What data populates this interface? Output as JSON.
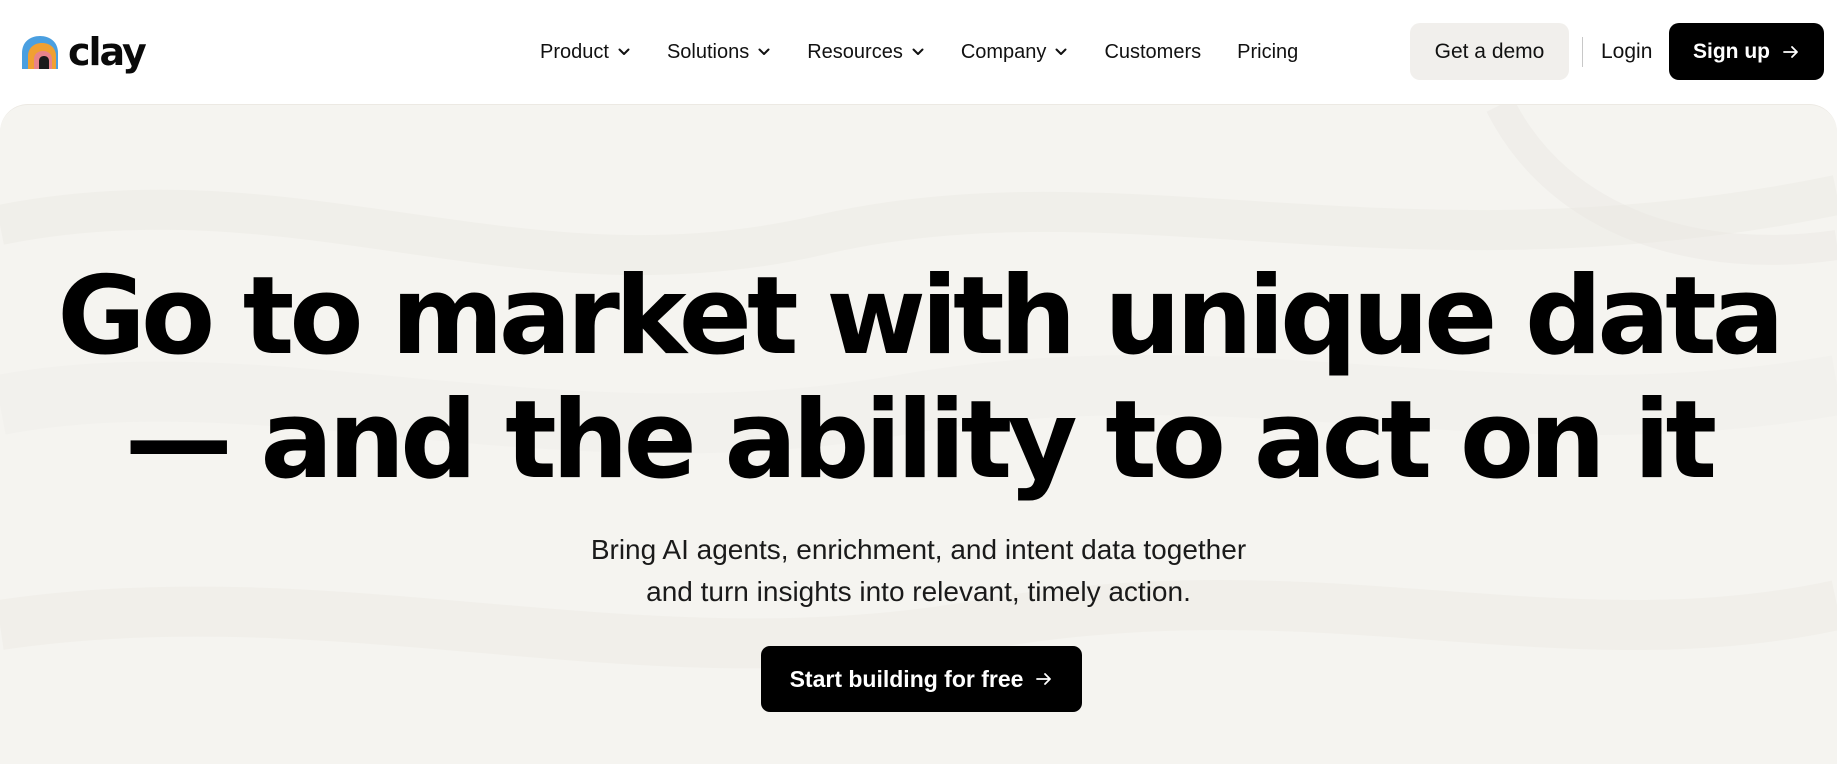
{
  "brand": {
    "name": "clay",
    "logo_icon": "clay-logo-icon",
    "logo_colors": {
      "blue": "#4a9fe0",
      "orange": "#f0a032",
      "pink": "#e8838a",
      "dark": "#1b1b1b"
    }
  },
  "nav": {
    "items": [
      {
        "label": "Product",
        "has_dropdown": true
      },
      {
        "label": "Solutions",
        "has_dropdown": true
      },
      {
        "label": "Resources",
        "has_dropdown": true
      },
      {
        "label": "Company",
        "has_dropdown": true
      },
      {
        "label": "Customers",
        "has_dropdown": false
      },
      {
        "label": "Pricing",
        "has_dropdown": false
      }
    ],
    "dropdown_icon": "chevron-down-icon"
  },
  "header_actions": {
    "demo_label": "Get a demo",
    "login_label": "Login",
    "signup_label": "Sign up",
    "signup_icon": "arrow-right-icon"
  },
  "hero": {
    "headline_line1": "Go to market with unique data",
    "headline_line2": "— and the ability to act on it",
    "subhead_line1": "Bring AI agents, enrichment, and intent data together",
    "subhead_line2": "and turn insights into relevant, timely action.",
    "cta_label": "Start building for free",
    "cta_icon": "arrow-right-icon"
  },
  "colors": {
    "primary_button_bg": "#000000",
    "secondary_button_bg": "#f1efec",
    "hero_bg": "#f5f4f0",
    "text": "#0a0a0a"
  }
}
